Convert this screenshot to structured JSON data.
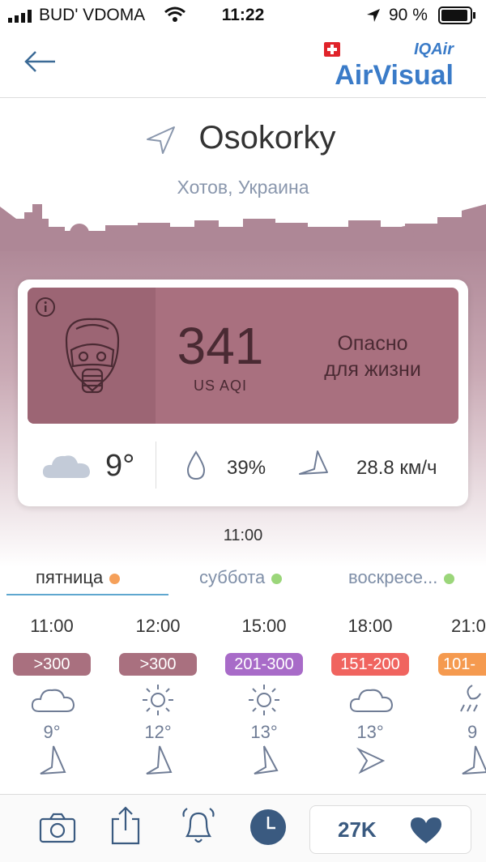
{
  "status_bar": {
    "carrier": "BUD' VDOMA",
    "time": "11:22",
    "battery": "90 %"
  },
  "header": {
    "brand_small": "IQAir",
    "brand_main": "AirVisual"
  },
  "location": {
    "city": "Osokorky",
    "region": "Хотов, Украина"
  },
  "aqi": {
    "value": "341",
    "unit": "US AQI",
    "status_line1": "Опасно",
    "status_line2": "для жизни",
    "color": "#a9707f"
  },
  "weather": {
    "temp": "9°",
    "humidity": "39%",
    "wind": "28.8 км/ч"
  },
  "updated_time": "11:00",
  "days": [
    {
      "label": "пятница",
      "dot_color": "#f5a05a"
    },
    {
      "label": "суббота",
      "dot_color": "#9bd67a"
    },
    {
      "label": "воскресе...",
      "dot_color": "#9bd67a"
    }
  ],
  "forecast": [
    {
      "time": "11:00",
      "aqi": ">300",
      "color": "#a9707f",
      "icon": "cloud-icon",
      "temp": "9°"
    },
    {
      "time": "12:00",
      "aqi": ">300",
      "color": "#a9707f",
      "icon": "sun-icon",
      "temp": "12°"
    },
    {
      "time": "15:00",
      "aqi": "201-300",
      "color": "#a86bc8",
      "icon": "sun-icon",
      "temp": "13°"
    },
    {
      "time": "18:00",
      "aqi": "151-200",
      "color": "#f0645f",
      "icon": "cloud-icon",
      "temp": "13°"
    },
    {
      "time": "21:0",
      "aqi": "101-",
      "color": "#f59a4f",
      "icon": "moon-rain-icon",
      "temp": "9"
    }
  ],
  "bottom_bar": {
    "likes": "27K"
  }
}
